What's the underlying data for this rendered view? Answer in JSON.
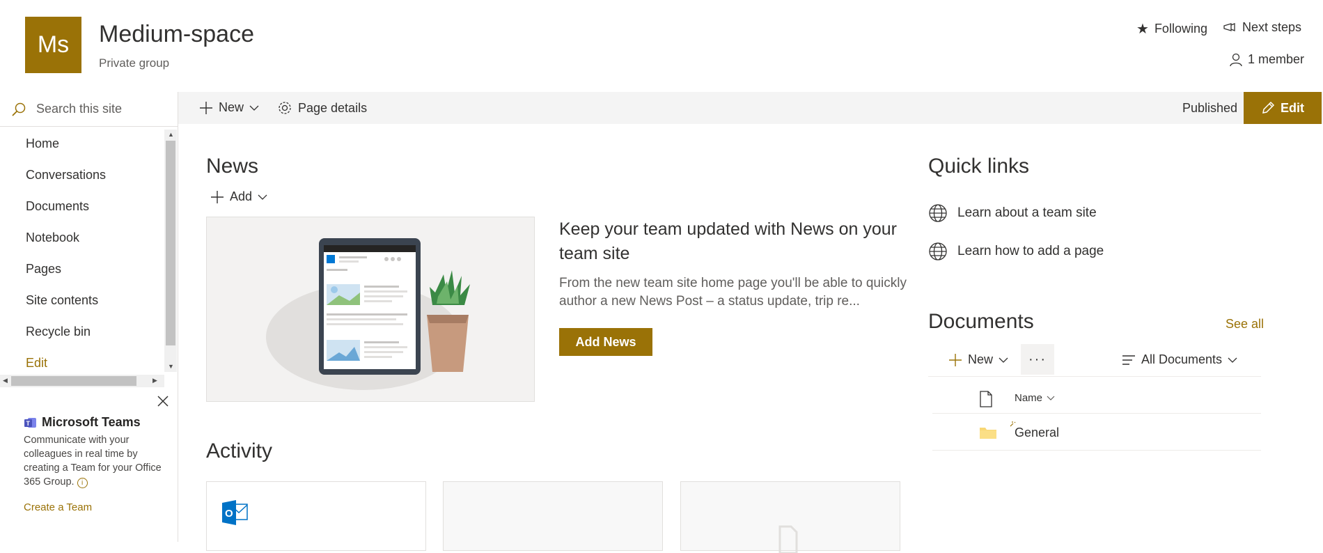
{
  "site": {
    "logo_initials": "Ms",
    "title": "Medium-space",
    "subtitle": "Private group",
    "following_label": "Following",
    "next_steps_label": "Next steps",
    "members_label": "1 member"
  },
  "commandbar": {
    "new_label": "New",
    "page_details_label": "Page details",
    "published_label": "Published",
    "edit_label": "Edit"
  },
  "leftnav": {
    "search_placeholder": "Search this site",
    "items": [
      "Home",
      "Conversations",
      "Documents",
      "Notebook",
      "Pages",
      "Site contents",
      "Recycle bin"
    ],
    "edit_label": "Edit"
  },
  "teams_promo": {
    "title": "Microsoft Teams",
    "description": "Communicate with your colleagues in real time by creating a Team for your Office 365 Group.",
    "cta": "Create a Team"
  },
  "news": {
    "title": "News",
    "add_label": "Add",
    "headline": "Keep your team updated with News on your team site",
    "body": "From the new team site home page you'll be able to quickly author a new News Post – a status update, trip re...",
    "add_news_label": "Add News"
  },
  "activity": {
    "title": "Activity"
  },
  "quick_links": {
    "title": "Quick links",
    "items": [
      "Learn about a team site",
      "Learn how to add a page"
    ]
  },
  "documents": {
    "title": "Documents",
    "see_all_label": "See all",
    "new_label": "New",
    "more_label": "···",
    "view_label": "All Documents",
    "name_header": "Name",
    "items": [
      "General"
    ]
  },
  "colors": {
    "accent": "#9a7207",
    "folder": "#f8d775"
  }
}
